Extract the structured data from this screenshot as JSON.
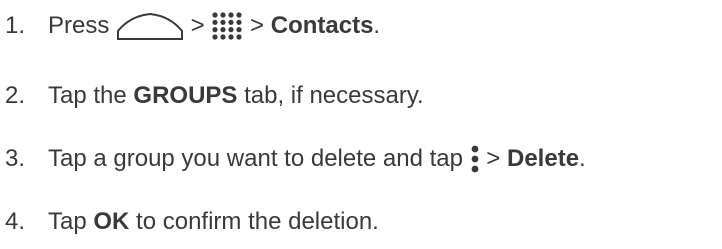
{
  "steps": [
    {
      "number": "1.",
      "before": "Press ",
      "icon1": "home-icon",
      "sep1": " > ",
      "icon2": "apps-grid-icon",
      "sep2": " > ",
      "bold": "Contacts",
      "after": "."
    },
    {
      "number": "2.",
      "before": "Tap the ",
      "bold": "GROUPS",
      "after": " tab, if necessary."
    },
    {
      "number": "3.",
      "before": "Tap a group you want to delete and tap ",
      "icon": "vertical-menu-icon",
      "sep": " > ",
      "bold": "Delete",
      "after": "."
    },
    {
      "number": "4.",
      "before": "Tap ",
      "bold": "OK",
      "after": " to confirm the deletion."
    }
  ],
  "colors": {
    "text": "#3a3a3a",
    "icon": "#3a3a3a"
  }
}
